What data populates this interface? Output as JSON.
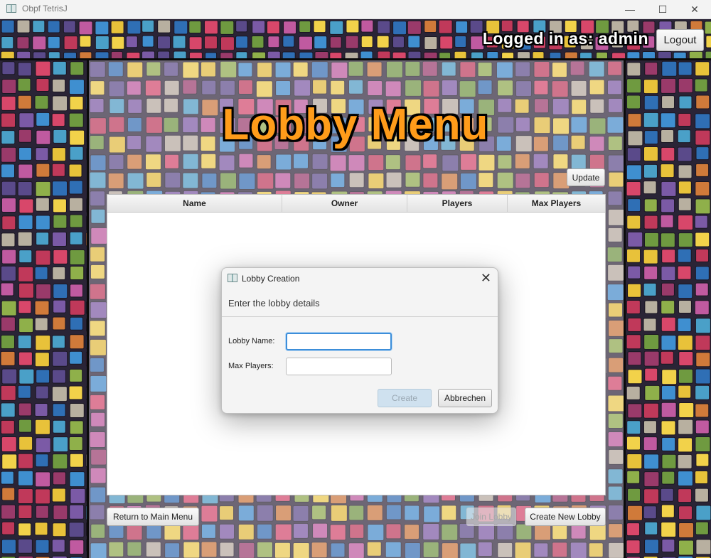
{
  "window": {
    "title": "Obpf TetrisJ",
    "minimize_icon": "—",
    "maximize_icon": "☐",
    "close_icon": "✕"
  },
  "header": {
    "logged_in_text": "Logged in as: admin",
    "logout_label": "Logout"
  },
  "page": {
    "title": "Lobby Menu",
    "update_label": "Update"
  },
  "table": {
    "columns": [
      "Name",
      "Owner",
      "Players",
      "Max Players"
    ],
    "rows": []
  },
  "footer": {
    "return_label": "Return to Main Menu",
    "join_label": "Join Lobby",
    "create_label": "Create New Lobby"
  },
  "dialog": {
    "title": "Lobby Creation",
    "header_text": "Enter the lobby details",
    "lobby_name_label": "Lobby Name:",
    "lobby_name_value": "",
    "max_players_label": "Max Players:",
    "max_players_value": "",
    "create_label": "Create",
    "cancel_label": "Abbrechen",
    "close_icon": "✕"
  },
  "colors": {
    "title_orange": "#ff9c1a",
    "focus_blue": "#3d8ed9"
  }
}
